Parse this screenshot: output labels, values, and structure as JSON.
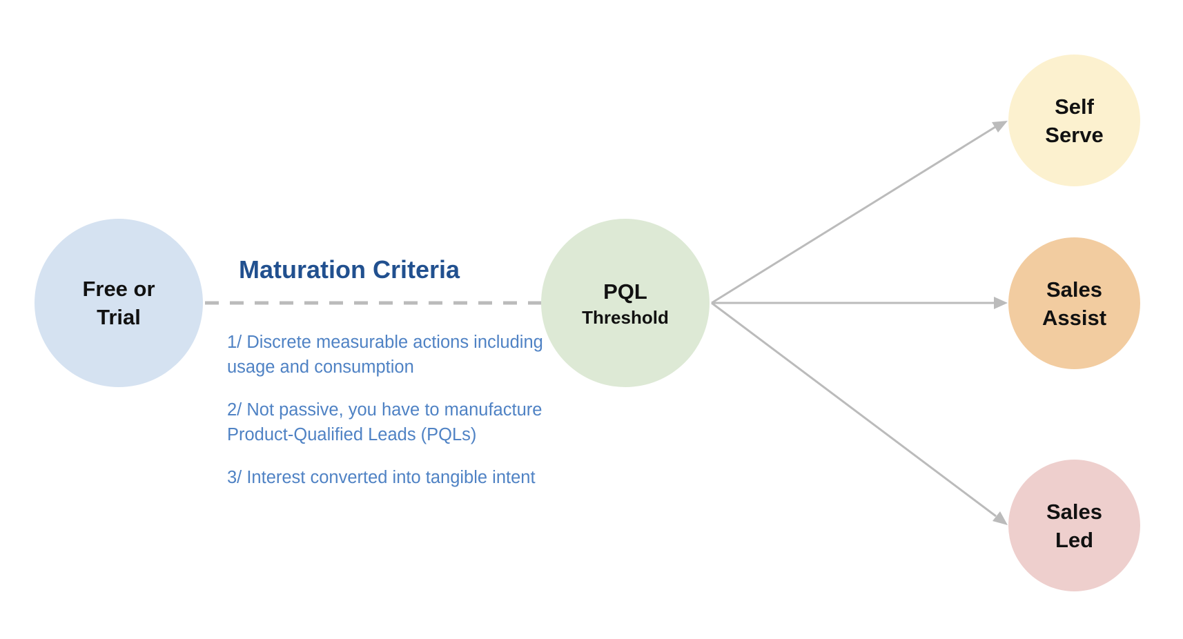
{
  "nodes": {
    "free_trial": {
      "line1": "Free or",
      "line2": "Trial",
      "color": "#d5e2f1"
    },
    "pql": {
      "line1": "PQL",
      "line2": "Threshold",
      "color": "#dde9d5"
    },
    "self_serve": {
      "line1": "Self",
      "line2": "Serve",
      "color": "#fcf1cf"
    },
    "sales_assist": {
      "line1": "Sales",
      "line2": "Assist",
      "color": "#f2cca0"
    },
    "sales_led": {
      "line1": "Sales",
      "line2": "Led",
      "color": "#eecfcd"
    }
  },
  "criteria": {
    "title": "Maturation Criteria",
    "items": [
      "1/ Discrete measurable actions including usage and consumption",
      "2/ Not passive, you have to manufacture Product-Qualified Leads (PQLs)",
      "3/ Interest converted into tangible intent"
    ]
  },
  "colors": {
    "connector": "#bbbbbb",
    "title": "#21508f",
    "notes": "#4f82c4"
  }
}
